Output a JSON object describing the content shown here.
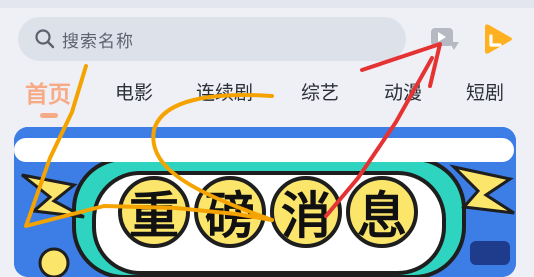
{
  "search": {
    "placeholder": "搜索名称"
  },
  "tabs": [
    {
      "label": "首页",
      "active": true
    },
    {
      "label": "电影"
    },
    {
      "label": "连续剧"
    },
    {
      "label": "综艺"
    },
    {
      "label": "动漫"
    },
    {
      "label": "短剧"
    }
  ],
  "banner": {
    "headline": [
      "重",
      "磅",
      "消",
      "息"
    ]
  },
  "colors": {
    "accent": "#f7aa86",
    "logo": "#ffb020",
    "banner_bg": "#3c7de6",
    "headline_bg": "#fbe56b",
    "annotation_orange": "#f4a300",
    "annotation_red": "#e53232"
  },
  "icons": [
    "search-icon",
    "download-icon",
    "app-logo-icon"
  ]
}
